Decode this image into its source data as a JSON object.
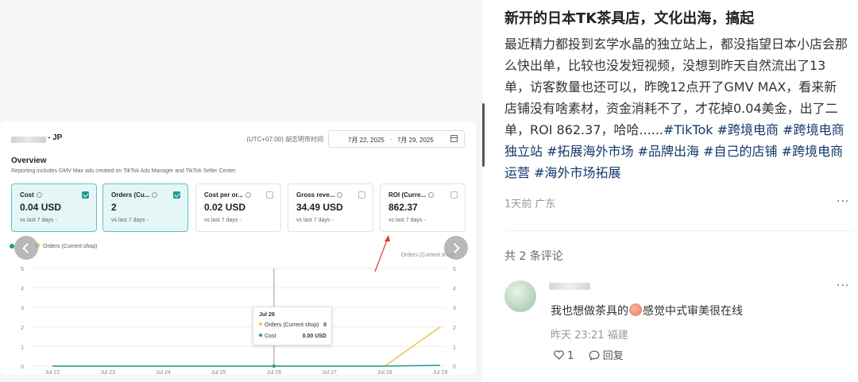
{
  "screenshot": {
    "shop_suffix": "- JP",
    "timezone": "(UTC+07:00) 胡志明市时间",
    "date_start": "7月 22, 2025",
    "date_sep": "-",
    "date_end": "7月 29, 2025",
    "overview_title": "Overview",
    "overview_subtitle": "Reporting includes GMV Max ads created on TikTok Ads Manager and TikTok Seller Center.",
    "kpis": [
      {
        "label": "Cost",
        "value": "0.04 USD",
        "vs": "vs last 7 days -",
        "selected": true
      },
      {
        "label": "Orders (Cu...",
        "value": "2",
        "vs": "vs last 7 days -",
        "selected": true
      },
      {
        "label": "Cost per or...",
        "value": "0.02 USD",
        "vs": "vs last 7 days -",
        "selected": false
      },
      {
        "label": "Gross reve...",
        "value": "34.49 USD",
        "vs": "vs last 7 days -",
        "selected": false
      },
      {
        "label": "ROI (Curre...",
        "value": "862.37",
        "vs": "vs last 7 days -",
        "selected": false
      }
    ],
    "legend_orders": "Orders (Current shop)",
    "legend_right": "Orders (Current shop)",
    "tooltip": {
      "date": "Jul 26",
      "rows": [
        {
          "label": "Orders (Current shop)",
          "value": "0"
        },
        {
          "label": "Cost",
          "value": "0.00 USD"
        }
      ]
    }
  },
  "chart_data": {
    "type": "line",
    "categories": [
      "Jul 22",
      "Jul 23",
      "Jul 24",
      "Jul 25",
      "Jul 26",
      "Jul 27",
      "Jul 28",
      "Jul 29"
    ],
    "series": [
      {
        "name": "Orders (Current shop)",
        "values": [
          0,
          0,
          0,
          0,
          0,
          0,
          0,
          2
        ]
      },
      {
        "name": "Cost",
        "values": [
          0,
          0,
          0,
          0,
          0,
          0,
          0,
          0.04
        ]
      }
    ],
    "y_ticks_left": [
      "5",
      "4",
      "3",
      "2",
      "1",
      "0"
    ],
    "y_ticks_right": [
      "5",
      "4",
      "3",
      "2",
      "1",
      "0"
    ],
    "ylim": [
      0,
      5
    ],
    "grid": true,
    "highlight_category": "Jul 26",
    "colors": {
      "orders": "#f2c14e",
      "cost": "#1e9a94",
      "arrow": "#e03b2f"
    }
  },
  "post": {
    "title": "新开的日本TK茶具店，文化出海，搞起",
    "body_text": "最近精力都投到玄学水晶的独立站上，都没指望日本小店会那么快出单，比较也没发短视频，没想到昨天自然流出了13单，访客数量也还可以，昨晚12点开了GMV MAX，看来新店铺没有啥素材，资金消耗不了，才花掉0.04美金，出了二单，ROI 862.37，哈哈......",
    "tags": [
      "#TikTok",
      "#跨境电商",
      "#跨境电商独立站",
      "#拓展海外市场",
      "#品牌出海",
      "#自己的店铺",
      "#跨境电商运营",
      "#海外市场拓展"
    ],
    "meta": "1天前 广东",
    "more": "···",
    "comment_count": "共 2 条评论"
  },
  "comment": {
    "text_before": "我也想做茶具的",
    "text_after": "感觉中式审美很在线",
    "time": "昨天 23:21 福建",
    "likes": "1",
    "reply_label": "回复",
    "more": "···"
  }
}
